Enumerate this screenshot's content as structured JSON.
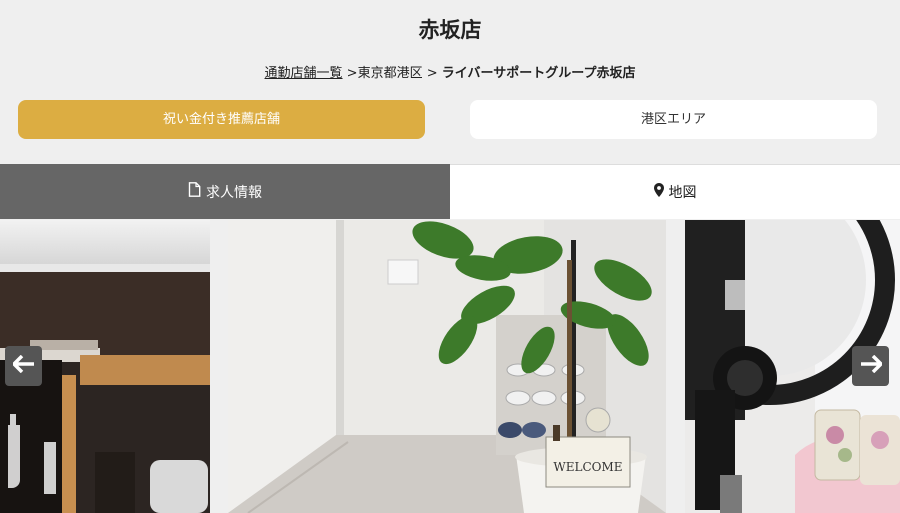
{
  "header": {
    "title": "赤坂店"
  },
  "breadcrumb": {
    "items": [
      {
        "label": "通勤店舗一覧",
        "link": true
      },
      {
        "label": ">東京都港区",
        "link": false
      },
      {
        "label": ">",
        "link": false
      },
      {
        "label": "ライバーサポートグループ赤坂店",
        "link": false
      }
    ]
  },
  "buttons": {
    "recommended": "祝い金付き推薦店舗",
    "area": "港区エリア"
  },
  "tabs": [
    {
      "label": "求人情報",
      "icon": "document-icon",
      "active": true
    },
    {
      "label": "地図",
      "icon": "map-pin-icon",
      "active": false
    }
  ],
  "gallery": {
    "photos": [
      {
        "name": "shelf-photo"
      },
      {
        "name": "welcome-plant-photo",
        "sign_text": "WELCOME"
      },
      {
        "name": "ring-light-photo"
      }
    ]
  },
  "colors": {
    "accent_gold": "#dcad42",
    "tab_active": "#666666",
    "arrow_bg": "#555555"
  }
}
